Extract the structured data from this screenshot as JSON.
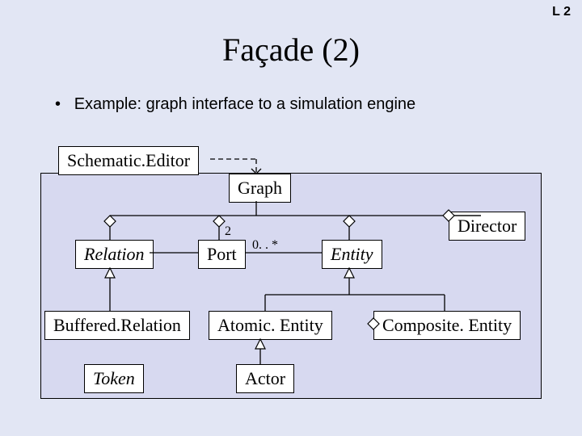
{
  "corner_label": "L 2",
  "title": "Façade (2)",
  "bullet_marker": "•",
  "bullet_text": "Example: graph interface to a simulation engine",
  "classes": {
    "schematic_editor": "Schematic.Editor",
    "graph": "Graph",
    "director": "Director",
    "relation": "Relation",
    "port": "Port",
    "entity": "Entity",
    "buffered_relation": "Buffered.Relation",
    "atomic_entity": "Atomic. Entity",
    "composite_entity": "Composite. Entity",
    "token": "Token",
    "actor": "Actor"
  },
  "multiplicity": {
    "two": "2",
    "zero_star": "0. . *"
  }
}
